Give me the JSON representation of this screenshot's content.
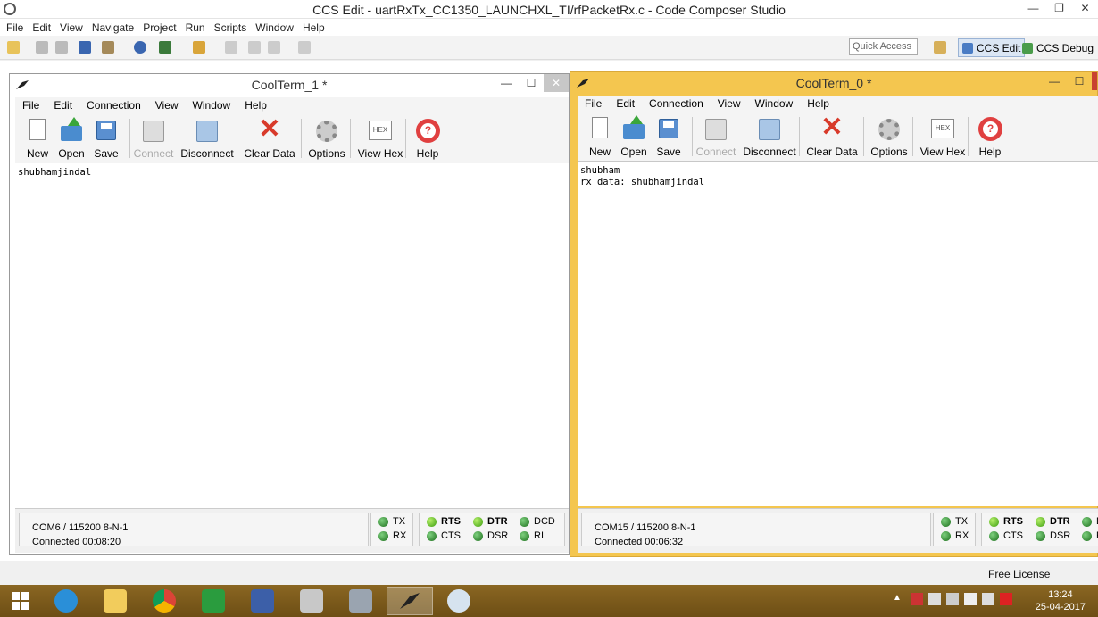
{
  "ccs": {
    "title": "CCS Edit - uartRxTx_CC1350_LAUNCHXL_TI/rfPacketRx.c - Code Composer Studio",
    "menu": [
      "File",
      "Edit",
      "View",
      "Navigate",
      "Project",
      "Run",
      "Scripts",
      "Window",
      "Help"
    ],
    "quick_access_placeholder": "Quick Access",
    "perspective_edit": "CCS Edit",
    "perspective_debug": "CCS Debug",
    "free_license": "Free License"
  },
  "coolterm1": {
    "title": "CoolTerm_1 *",
    "menu": [
      "File",
      "Edit",
      "Connection",
      "View",
      "Window",
      "Help"
    ],
    "toolbar": [
      "New",
      "Open",
      "Save",
      "Connect",
      "Disconnect",
      "Clear Data",
      "Options",
      "View Hex",
      "Help"
    ],
    "terminal_text": "shubhamjindal",
    "port": "COM6 / 115200 8-N-1",
    "connected": "Connected 00:08:20",
    "leds": {
      "tx": "TX",
      "rx": "RX",
      "rts": "RTS",
      "cts": "CTS",
      "dtr": "DTR",
      "dsr": "DSR",
      "dcd": "DCD",
      "ri": "RI"
    }
  },
  "coolterm0": {
    "title": "CoolTerm_0 *",
    "menu": [
      "File",
      "Edit",
      "Connection",
      "View",
      "Window",
      "Help"
    ],
    "toolbar": [
      "New",
      "Open",
      "Save",
      "Connect",
      "Disconnect",
      "Clear Data",
      "Options",
      "View Hex",
      "Help"
    ],
    "terminal_text": "shubham\nrx data: shubhamjindal",
    "port": "COM15 / 115200 8-N-1",
    "connected": "Connected 00:06:32",
    "leds": {
      "tx": "TX",
      "rx": "RX",
      "rts": "RTS",
      "cts": "CTS",
      "dtr": "DTR",
      "dsr": "DSR",
      "dcd": "D",
      "ri": "R"
    }
  },
  "taskbar": {
    "time": "13:24",
    "date": "25-04-2017",
    "icons": [
      "start-icon",
      "internet-explorer-icon",
      "file-explorer-icon",
      "chrome-icon",
      "store-icon",
      "network-tool-icon",
      "package-icon",
      "installer-icon",
      "coolterm-icon",
      "paint-icon"
    ]
  },
  "colors": {
    "active_title": "#f4c64f",
    "inactive_title": "#ffffff",
    "taskbar": "#7a5a1c"
  }
}
